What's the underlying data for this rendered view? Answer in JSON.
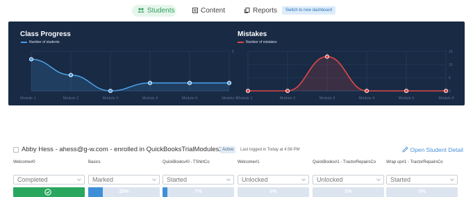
{
  "nav": {
    "students_label": "Students",
    "content_label": "Content",
    "reports_label": "Reports",
    "switch_label": "Switch to new dashboard",
    "icons": [
      "people-icon",
      "content-icon",
      "reports-icon"
    ]
  },
  "charts": {
    "background": "#182a44",
    "progress_title": "Class Progress",
    "progress_legend": "Number of students",
    "progress_color": "#4a9de3",
    "mistakes_title": "Mistakes",
    "mistakes_legend": "Number of mistakes",
    "mistakes_color": "#e04848"
  },
  "chart_data": [
    {
      "type": "line",
      "title": "Class Progress",
      "categories": [
        "Module 1",
        "Module 2",
        "Module 3",
        "Module 4",
        "Module 5",
        "Module 6"
      ],
      "series": [
        {
          "name": "Number of students",
          "values": [
            4,
            2,
            0,
            1,
            1,
            1
          ]
        }
      ],
      "y_ticks": [
        "5"
      ],
      "ylim": [
        0,
        5
      ],
      "grid": true,
      "legend": "top-left"
    },
    {
      "type": "line",
      "title": "Mistakes",
      "categories": [
        "Module 1",
        "Module 2",
        "Module 3",
        "Module 4",
        "Module 5",
        "Module 6"
      ],
      "series": [
        {
          "name": "Number of mistakes",
          "values": [
            0,
            0,
            13,
            0,
            0,
            0
          ]
        }
      ],
      "y_ticks": [
        "0",
        "5",
        "10",
        "15"
      ],
      "ylim": [
        0,
        15
      ],
      "grid": true,
      "legend": "top-left"
    }
  ],
  "student": {
    "name_line": "Abby Hess - ahess@g-w.com - enrolled in QuickBooksTrialModules23",
    "status_badge": "Active",
    "last_login": "Last logged in Today at 4:56 PM",
    "open_detail": "Open Student Detail"
  },
  "modules": [
    {
      "label": "Welcome#0",
      "status": "Completed",
      "progress": 100,
      "progress_text": ""
    },
    {
      "label": "Basics",
      "status": "Marked",
      "progress": 20,
      "progress_text": "20%"
    },
    {
      "label": "QuickBooks#0 - TShirtCo",
      "status": "Started",
      "progress": 7,
      "progress_text": "7%"
    },
    {
      "label": "Welcome#1",
      "status": "Unlocked",
      "progress": 0,
      "progress_text": "0%"
    },
    {
      "label": "QuickBooks#1 - TractorRepairsCo",
      "status": "Unlocked",
      "progress": 0,
      "progress_text": "0%"
    },
    {
      "label": "Wrap up#1 - TractorRepairsCo",
      "status": "Started",
      "progress": 0,
      "progress_text": "0%"
    }
  ]
}
